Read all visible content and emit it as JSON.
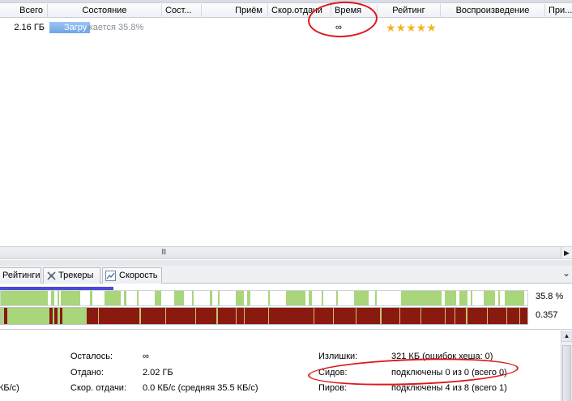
{
  "columns": {
    "total": "Всего",
    "state": "Состояние",
    "done": "Сост...",
    "received": "Приём",
    "upload_speed": "Скор.отдачи",
    "time": "Время",
    "rating": "Рейтинг",
    "playback": "Воспроизведение",
    "priority": "При..."
  },
  "torrent": {
    "total": "2.16 ГБ",
    "state_text": "Загружается 35.8%",
    "state_text_inside": "Загру",
    "state_text_outside": "жается 35.8%",
    "progress": 0.358,
    "time": "∞",
    "rating_stars": "★★★★★",
    "rating_value": 5
  },
  "scrollbar": {
    "grip": "III",
    "arrow_right": "▶"
  },
  "tabs": {
    "ratings": "Рейтинги",
    "trackers": "Трекеры",
    "speed": "Скорость",
    "collapse": "⌄"
  },
  "progress_panel": {
    "percent_label": "35.8 %",
    "availability_label": "0.357"
  },
  "info": {
    "remaining_label": "Осталось:",
    "remaining_value": "∞",
    "uploaded_label": "Отдано:",
    "uploaded_value": "2.02 ГБ",
    "upload_speed_label": "Скор. отдачи:",
    "upload_speed_value": "0.0 КБ/с (средняя 35.5 КБ/с)",
    "left_fragment": "КБ/с)",
    "wasted_label": "Излишки:",
    "wasted_value": "321 КБ (ошибок хеша: 0)",
    "seeds_label": "Сидов:",
    "seeds_value": "подключены 0 из 0 (всего 0)",
    "peers_label": "Пиров:",
    "peers_value": "подключены 4 из 8 (всего 1)"
  },
  "colors": {
    "annotation": "#e0171a",
    "progress_blue": "#4a4ad8",
    "piece_green": "#a9d67a",
    "availability_red": "#8a1a10",
    "star_gold": "#f2b522"
  }
}
